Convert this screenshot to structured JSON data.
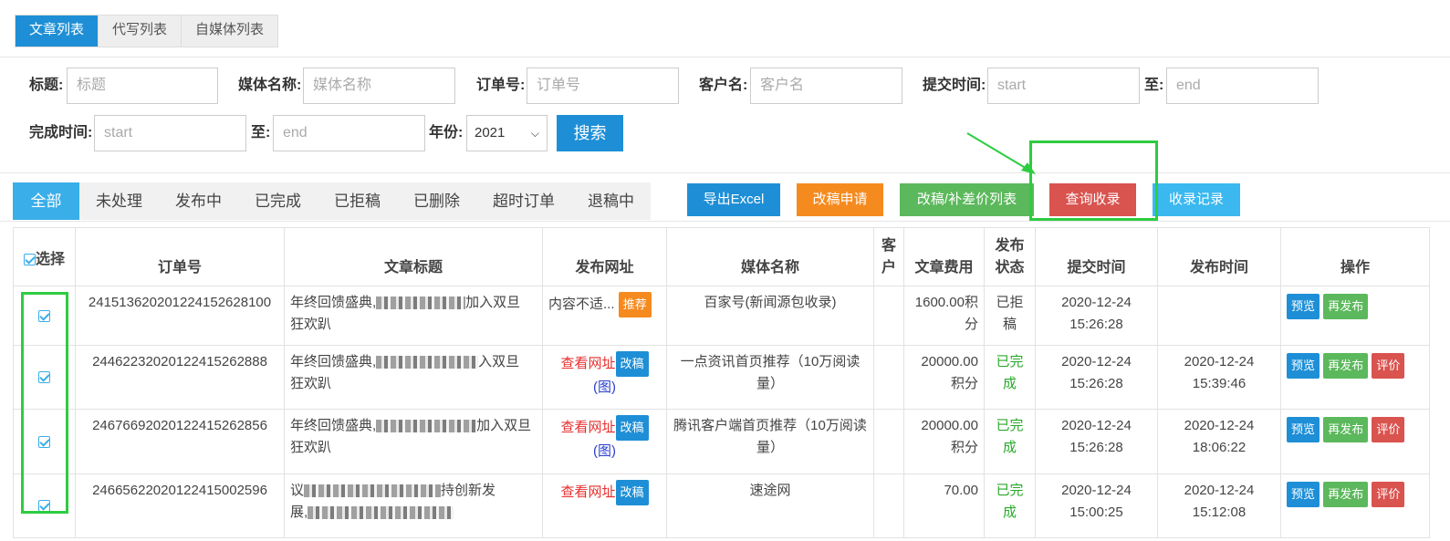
{
  "top_tabs": [
    "文章列表",
    "代写列表",
    "自媒体列表"
  ],
  "filters": {
    "title_label": "标题:",
    "title_ph": "标题",
    "media_label": "媒体名称:",
    "media_ph": "媒体名称",
    "order_label": "订单号:",
    "order_ph": "订单号",
    "customer_label": "客户名:",
    "customer_ph": "客户名",
    "submit_label": "提交时间:",
    "submit_start_ph": "start",
    "to1": "至:",
    "submit_end_ph": "end",
    "finish_label": "完成时间:",
    "finish_start_ph": "start",
    "to2": "至:",
    "finish_end_ph": "end",
    "year_label": "年份:",
    "year_value": "2021",
    "search_btn": "搜索"
  },
  "status_tabs": [
    "全部",
    "未处理",
    "发布中",
    "已完成",
    "已拒稿",
    "已删除",
    "超时订单",
    "退稿中"
  ],
  "actions": {
    "export": "导出Excel",
    "revise": "改稿申请",
    "revise_list": "改稿/补差价列表",
    "query_income": "查询收录",
    "income_record": "收录记录"
  },
  "table": {
    "headers": {
      "select": "选择",
      "order": "订单号",
      "title": "文章标题",
      "url": "发布网址",
      "media": "媒体名称",
      "customer_1": "客",
      "customer_2": "户",
      "fee": "文章费用",
      "status_1": "发布",
      "status_2": "状态",
      "submit_time": "提交时间",
      "publish_time": "发布时间",
      "ops": "操作"
    },
    "rows": [
      {
        "order": "24151362020122415262810​0",
        "title_a": "年终回馈盛典,",
        "title_b": "加入双旦",
        "title_c": "狂欢趴",
        "url_text": "内容不适...",
        "url_btn": "推荐",
        "media": "百家号(新闻源包收录)",
        "fee": "1600.00积分",
        "status": "已拒稿",
        "submit_date": "2020-12-24",
        "submit_time": "15:26:28",
        "pub_date": "",
        "pub_time": "",
        "b1": "预览",
        "b2": "再发布",
        "b3": ""
      },
      {
        "order": "2446223202012241526288​8",
        "title_a": "年终回馈盛典,",
        "title_b": "入双旦",
        "title_c": "狂欢趴",
        "url_text": "查看网址",
        "url_btn": "改稿",
        "url_img": "(图)",
        "media": "一点资讯首页推荐（10万阅读量）",
        "fee": "20000.00积分",
        "status": "已完成",
        "submit_date": "2020-12-24",
        "submit_time": "15:26:28",
        "pub_date": "2020-12-24",
        "pub_time": "15:39:46",
        "b1": "预览",
        "b2": "再发布",
        "b3": "评价"
      },
      {
        "order": "2467669202012241526285​6",
        "title_a": "年终回馈盛典,",
        "title_b": "加入双旦",
        "title_c": "狂欢趴",
        "url_text": "查看网址",
        "url_btn": "改稿",
        "url_img": "(图)",
        "media": "腾讯客户端首页推荐（10万阅读量）",
        "fee": "20000.00积分",
        "status": "已完成",
        "submit_date": "2020-12-24",
        "submit_time": "15:26:28",
        "pub_date": "2020-12-24",
        "pub_time": "18:06:22",
        "b1": "预览",
        "b2": "再发布",
        "b3": "评价"
      },
      {
        "order": "2466562202012241500259​6",
        "title_a": "议",
        "title_b": "持创新发",
        "title_c": "展,",
        "url_text": "查看网址",
        "url_btn": "改稿",
        "media": "速途网",
        "fee": "70.00",
        "status": "已完成",
        "submit_date": "2020-12-24",
        "submit_time": "15:00:25",
        "pub_date": "2020-12-24",
        "pub_time": "15:12:08",
        "b1": "预览",
        "b2": "再发布",
        "b3": "评价"
      }
    ]
  }
}
